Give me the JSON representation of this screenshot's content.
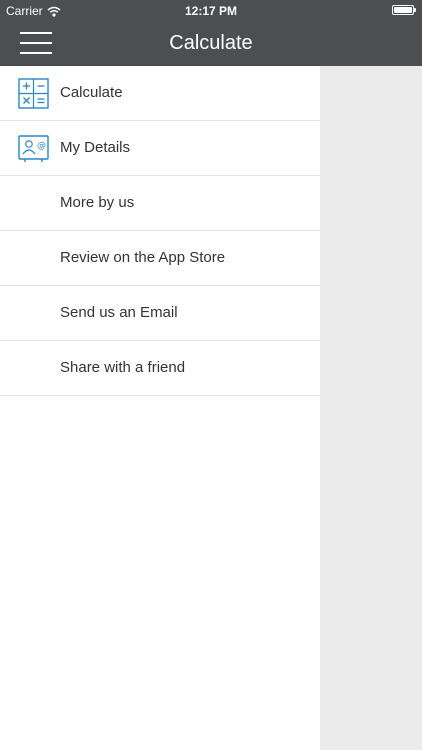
{
  "status_bar": {
    "carrier": "Carrier",
    "time": "12:17 PM"
  },
  "nav_bar": {
    "title": "Calculate"
  },
  "menu": {
    "items": [
      {
        "label": "Calculate",
        "icon": "calculator-icon"
      },
      {
        "label": "My Details",
        "icon": "contact-card-icon"
      },
      {
        "label": "More by us"
      },
      {
        "label": "Review on the App Store"
      },
      {
        "label": "Send us an Email"
      },
      {
        "label": "Share with a friend"
      }
    ]
  },
  "colors": {
    "nav_background": "#4b4f52",
    "accent_blue": "#2a86c8",
    "drawer_background": "#ffffff",
    "content_background": "#ebebeb",
    "divider": "#e2e2e2"
  }
}
